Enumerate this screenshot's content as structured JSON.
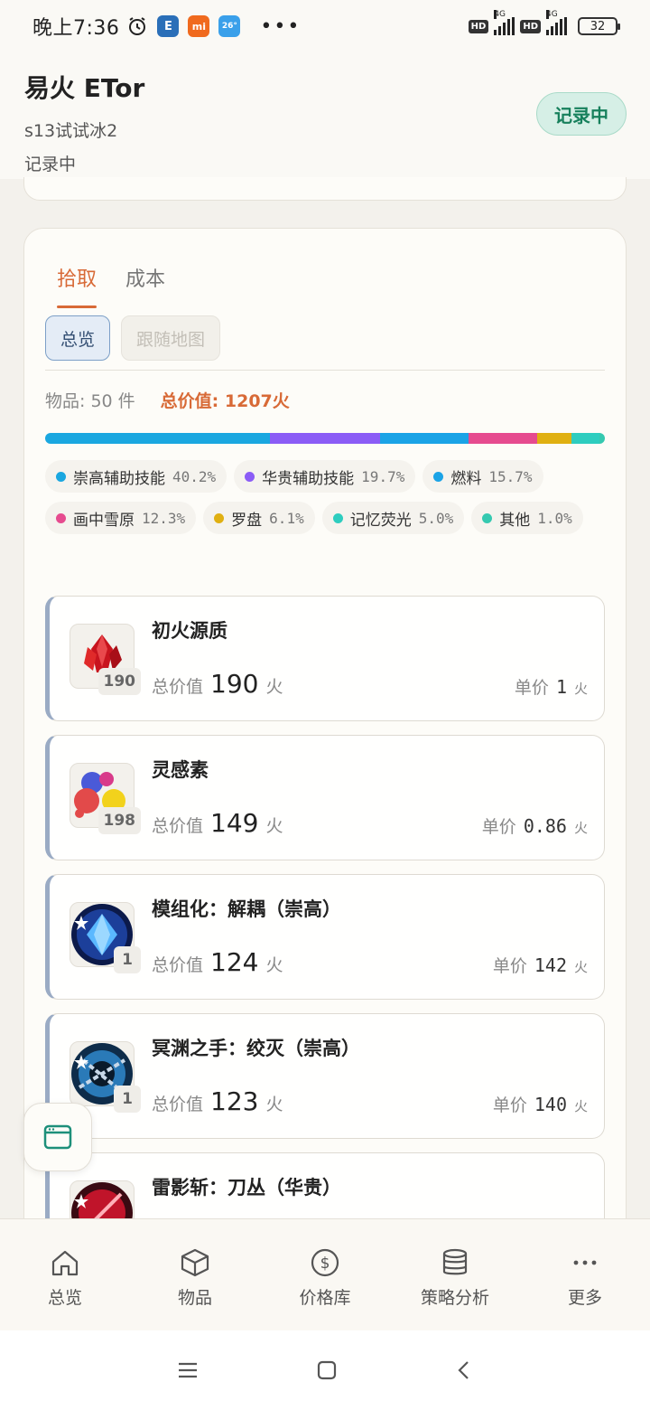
{
  "status_bar": {
    "time": "晚上7:36",
    "network": "4G",
    "battery": "32",
    "hd": "HD"
  },
  "header": {
    "title": "易火 ETor",
    "subtitle": "s13试试冰2",
    "status": "记录中",
    "record_button": "记录中"
  },
  "tabs": [
    {
      "label": "拾取",
      "active": true
    },
    {
      "label": "成本",
      "active": false
    }
  ],
  "subtabs": [
    {
      "label": "总览",
      "active": true
    },
    {
      "label": "跟随地图",
      "active": false
    }
  ],
  "summary": {
    "count": "物品: 50 件",
    "total": "总价值: 1207火"
  },
  "breakdown": [
    {
      "label": "崇高辅助技能",
      "pct": "40.2%",
      "value": 40.2,
      "color": "#1aa7e0"
    },
    {
      "label": "华贵辅助技能",
      "pct": "19.7%",
      "value": 19.7,
      "color": "#8b5cf6"
    },
    {
      "label": "燃料",
      "pct": "15.7%",
      "value": 15.7,
      "color": "#1ba3e6"
    },
    {
      "label": "画中雪原",
      "pct": "12.3%",
      "value": 12.3,
      "color": "#e64b8f"
    },
    {
      "label": "罗盘",
      "pct": "6.1%",
      "value": 6.1,
      "color": "#e0b012"
    },
    {
      "label": "记忆荧光",
      "pct": "5.0%",
      "value": 5.0,
      "color": "#2ecdbf"
    },
    {
      "label": "其他",
      "pct": "1.0%",
      "value": 1.0,
      "color": "#35c9b0"
    }
  ],
  "items": [
    {
      "name": "初火源质",
      "qty": "190",
      "total_label": "总价值",
      "total": "190",
      "unit_label": "单价",
      "unit_price": "1",
      "currency": "火",
      "icon": "red-crystal-icon"
    },
    {
      "name": "灵感素",
      "qty": "198",
      "total_label": "总价值",
      "total": "149",
      "unit_label": "单价",
      "unit_price": "0.86",
      "currency": "火",
      "icon": "paint-splash-icon"
    },
    {
      "name": "模组化：解耦（崇高）",
      "qty": "1",
      "total_label": "总价值",
      "total": "124",
      "unit_label": "单价",
      "unit_price": "142",
      "currency": "火",
      "icon": "blue-gem-skill-icon"
    },
    {
      "name": "冥渊之手：绞灭（崇高）",
      "qty": "1",
      "total_label": "总价值",
      "total": "123",
      "unit_label": "单价",
      "unit_price": "140",
      "currency": "火",
      "icon": "chain-skill-icon"
    },
    {
      "name": "雷影斩：刀丛（华贵）",
      "qty": "",
      "total_label": "",
      "total": "",
      "unit_label": "",
      "unit_price": "",
      "currency": "",
      "icon": "red-slash-skill-icon"
    }
  ],
  "bottom_nav": [
    {
      "label": "总览",
      "icon": "home-icon"
    },
    {
      "label": "物品",
      "icon": "box-icon"
    },
    {
      "label": "价格库",
      "icon": "dollar-icon"
    },
    {
      "label": "策略分析",
      "icon": "database-icon"
    },
    {
      "label": "更多",
      "icon": "more-icon"
    }
  ]
}
